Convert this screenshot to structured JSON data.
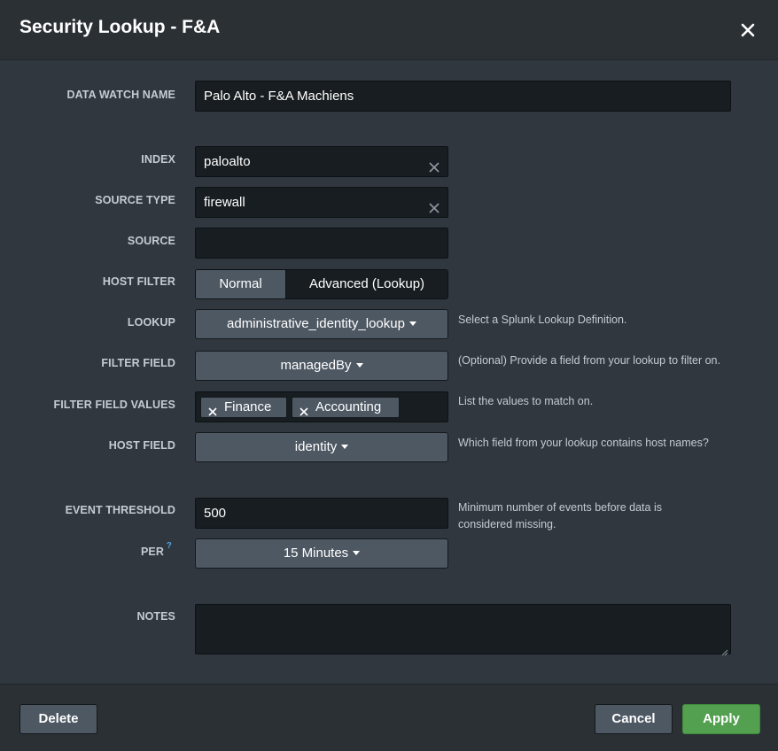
{
  "modal": {
    "title": "Security Lookup - F&A"
  },
  "form": {
    "data_watch_name": {
      "label": "DATA WATCH NAME",
      "value": "Palo Alto - F&A Machiens"
    },
    "index": {
      "label": "INDEX",
      "value": "paloalto"
    },
    "source_type": {
      "label": "SOURCE TYPE",
      "value": "firewall"
    },
    "source": {
      "label": "SOURCE",
      "value": ""
    },
    "host_filter": {
      "label": "HOST FILTER",
      "options": [
        "Normal",
        "Advanced (Lookup)"
      ],
      "selected": "Normal"
    },
    "lookup": {
      "label": "LOOKUP",
      "value": "administrative_identity_lookup",
      "help": "Select a Splunk Lookup Definition."
    },
    "filter_field": {
      "label": "FILTER FIELD",
      "value": "managedBy",
      "help": "(Optional) Provide a field from your lookup to filter on."
    },
    "filter_field_values": {
      "label": "FILTER FIELD VALUES",
      "values": [
        "Finance",
        "Accounting"
      ],
      "help": "List the values to match on."
    },
    "host_field": {
      "label": "HOST FIELD",
      "value": "identity",
      "help": "Which field from your lookup contains host names?"
    },
    "event_threshold": {
      "label": "EVENT THRESHOLD",
      "value": "500",
      "help": "Minimum number of events before data is considered missing."
    },
    "per": {
      "label": "PER",
      "help_marker": "?",
      "value": "15 Minutes"
    },
    "notes": {
      "label": "NOTES",
      "value": ""
    }
  },
  "footer": {
    "delete_label": "Delete",
    "cancel_label": "Cancel",
    "apply_label": "Apply"
  },
  "colors": {
    "background": "#31373e",
    "header": "#2b3035",
    "input": "#171d21",
    "button": "#4e5863",
    "primary": "#53a051",
    "label": "#c3cbd4",
    "help_marker": "#4fa4de"
  },
  "icons": {
    "close": "close-icon",
    "clear": "clear-icon",
    "caret": "caret-down-icon",
    "chip_remove": "remove-x-icon",
    "resize": "resize-handle-icon"
  }
}
